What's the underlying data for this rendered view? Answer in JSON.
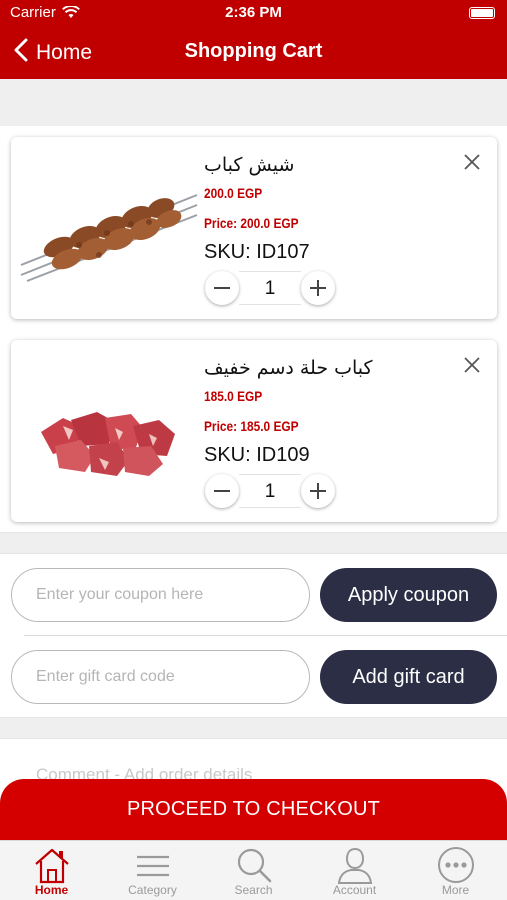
{
  "status_bar": {
    "carrier": "Carrier",
    "time": "2:36 PM"
  },
  "nav": {
    "back_label": "Home",
    "title": "Shopping Cart"
  },
  "cart_items": [
    {
      "name": "شيش كباب",
      "price": "200.0 EGP",
      "price_line": "Price: 200.0 EGP",
      "sku": "SKU: ID107",
      "quantity": "1",
      "image": "shish-kebab-image"
    },
    {
      "name": "كباب حلة دسم خفيف",
      "price": "185.0 EGP",
      "price_line": "Price: 185.0 EGP",
      "sku": "SKU: ID109",
      "quantity": "1",
      "image": "raw-meat-cubes-image"
    }
  ],
  "coupon": {
    "placeholder": "Enter your coupon here",
    "button": "Apply coupon"
  },
  "gift_card": {
    "placeholder": "Enter gift card code",
    "button": "Add gift card"
  },
  "comment": {
    "placeholder": "Comment - Add order details"
  },
  "checkout": {
    "label": "PROCEED TO CHECKOUT"
  },
  "tabbar": {
    "items": [
      {
        "label": "Home",
        "icon": "home-icon",
        "active": true
      },
      {
        "label": "Category",
        "icon": "list-icon",
        "active": false
      },
      {
        "label": "Search",
        "icon": "search-icon",
        "active": false
      },
      {
        "label": "Account",
        "icon": "person-icon",
        "active": false
      },
      {
        "label": "More",
        "icon": "more-icon",
        "active": false
      }
    ]
  },
  "colors": {
    "brand_red": "#c00000",
    "checkout_red": "#d40000",
    "dark_button": "#2b2e45",
    "price_red": "#c00000"
  }
}
